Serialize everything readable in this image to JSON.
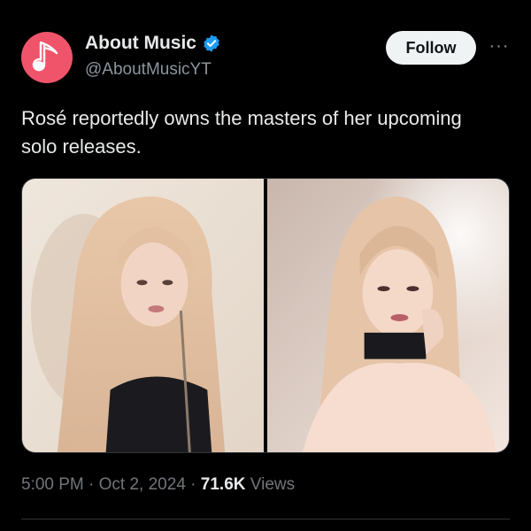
{
  "author": {
    "display_name": "About Music",
    "handle": "@AboutMusicYT",
    "avatar_icon": "music-note-icon",
    "avatar_color": "#f0546b",
    "verified": true,
    "verified_color": "#1d9bf0"
  },
  "actions": {
    "follow_label": "Follow",
    "more_label": "···"
  },
  "tweet": {
    "text": "Rosé reportedly owns the masters of her upcoming solo releases."
  },
  "media": {
    "count": 2
  },
  "meta": {
    "time": "5:00 PM",
    "separator": "·",
    "date": "Oct 2, 2024",
    "views_count": "71.6K",
    "views_label": "Views"
  },
  "colors": {
    "background": "#000000",
    "text": "#e7e9ea",
    "muted": "#71767b",
    "follow_bg": "#eff3f4"
  }
}
